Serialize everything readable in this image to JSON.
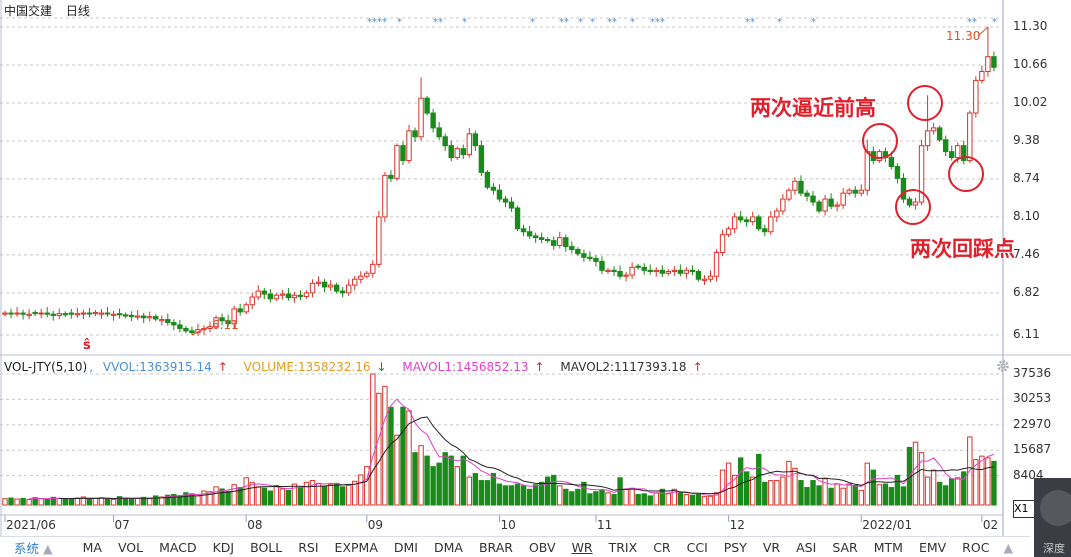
{
  "header": {
    "stock_name": "中国交建",
    "period": "日线"
  },
  "price_axis": {
    "labels": [
      "11.30",
      "10.66",
      "10.02",
      "9.38",
      "8.74",
      "8.10",
      "7.46",
      "6.82",
      "6.11"
    ],
    "range": [
      6.11,
      11.3
    ]
  },
  "volume_axis": {
    "labels": [
      "37536",
      "30253",
      "22970",
      "15687",
      "8404"
    ],
    "max": 37536
  },
  "x_axis": {
    "labels": [
      "2021/06",
      "07",
      "08",
      "09",
      "10",
      "11",
      "12",
      "2022/01",
      "02"
    ],
    "label_candle_index": [
      0,
      18,
      40,
      60,
      82,
      98,
      120,
      142,
      162
    ]
  },
  "legend": {
    "name": "VOL-JTY(5,10)",
    "sep": ",",
    "vvol": "VVOL:1363915.14",
    "vvol_arrow": "↑",
    "volume": "VOLUME:1358232.16",
    "volume_arrow": "↓",
    "mavol1": "MAVOL1:1456852.13",
    "mavol1_arrow": "↑",
    "mavol2": "MAVOL2:1117393.18",
    "mavol2_arrow": "↑"
  },
  "annotations": {
    "near_high": "两次逼近前高",
    "pullback": "两次回踩点",
    "max_label": "11.30",
    "min_label": "6.11",
    "signal_mark": "ŝ"
  },
  "stars": [
    "****",
    "*",
    "**",
    "*",
    "*",
    "**",
    "*",
    "*",
    "**",
    "*",
    "***",
    "**",
    "*",
    "*",
    "**",
    "*"
  ],
  "colors": {
    "up": "#d9352b",
    "down": "#1a8a1a",
    "grid": "#c8c8c8",
    "ma5": "#e040c8",
    "ma10": "#222222",
    "accent": "#2d7fd3",
    "annotation": "#e0202a"
  },
  "tabs": {
    "system": "系统",
    "items": [
      "MA",
      "VOL",
      "MACD",
      "KDJ",
      "BOLL",
      "RSI",
      "EXPMA",
      "DMI",
      "DMA",
      "BRAR",
      "OBV",
      "WR",
      "TRIX",
      "CR",
      "CCI",
      "PSY",
      "VR",
      "ASI",
      "SAR",
      "MTM",
      "EMV",
      "ROC"
    ]
  },
  "side": {
    "zoom_box": "X1",
    "widget_text": "深度"
  },
  "chart_data": {
    "type": "candlestick",
    "title": "中国交建 日线",
    "closes": [
      6.48,
      6.47,
      6.48,
      6.46,
      6.46,
      6.47,
      6.48,
      6.46,
      6.44,
      6.47,
      6.45,
      6.46,
      6.47,
      6.48,
      6.47,
      6.49,
      6.48,
      6.47,
      6.46,
      6.45,
      6.43,
      6.42,
      6.43,
      6.4,
      6.42,
      6.38,
      6.37,
      6.32,
      6.28,
      6.22,
      6.18,
      6.15,
      6.2,
      6.22,
      6.25,
      6.4,
      6.35,
      6.3,
      6.55,
      6.5,
      6.62,
      6.75,
      6.85,
      6.8,
      6.72,
      6.78,
      6.8,
      6.74,
      6.78,
      6.76,
      6.82,
      6.98,
      7.0,
      6.92,
      6.95,
      6.85,
      6.82,
      6.95,
      7.05,
      7.1,
      7.15,
      7.3,
      8.1,
      8.8,
      8.75,
      9.3,
      9.05,
      9.55,
      9.45,
      10.1,
      9.85,
      9.6,
      9.45,
      9.3,
      9.1,
      9.25,
      9.15,
      9.5,
      9.3,
      8.85,
      8.6,
      8.55,
      8.4,
      8.35,
      8.25,
      7.9,
      7.85,
      7.78,
      7.75,
      7.72,
      7.7,
      7.62,
      7.75,
      7.6,
      7.55,
      7.48,
      7.42,
      7.4,
      7.35,
      7.2,
      7.2,
      7.18,
      7.1,
      7.12,
      7.25,
      7.25,
      7.2,
      7.18,
      7.2,
      7.15,
      7.18,
      7.2,
      7.15,
      7.2,
      7.18,
      7.05,
      7.05,
      7.1,
      7.5,
      7.8,
      7.9,
      8.1,
      8.05,
      8.02,
      8.1,
      7.9,
      7.85,
      8.1,
      8.2,
      8.4,
      8.55,
      8.7,
      8.5,
      8.45,
      8.35,
      8.2,
      8.4,
      8.28,
      8.3,
      8.5,
      8.55,
      8.5,
      8.55,
      9.2,
      9.05,
      9.2,
      9.1,
      8.95,
      8.75,
      8.4,
      8.3,
      8.35,
      9.3,
      9.55,
      9.6,
      9.4,
      9.2,
      9.1,
      9.3,
      9.05,
      9.85,
      10.4,
      10.55,
      10.8,
      10.62
    ],
    "high_overrides": {
      "69": 10.45,
      "163": 11.3,
      "153": 10.15,
      "143": 9.4
    },
    "low_overrides": {
      "31": 6.11
    },
    "volumes": [
      1800,
      2000,
      1700,
      1900,
      1600,
      2100,
      1800,
      1700,
      2200,
      1900,
      1600,
      1800,
      2000,
      2300,
      1700,
      1900,
      2100,
      1800,
      1600,
      2400,
      2000,
      1700,
      1900,
      2200,
      1800,
      2600,
      2300,
      2800,
      3000,
      2700,
      3500,
      3200,
      2600,
      4000,
      3800,
      5200,
      4600,
      3900,
      5800,
      5000,
      7800,
      6400,
      5200,
      4800,
      4000,
      5600,
      4600,
      4200,
      6000,
      5000,
      6500,
      7000,
      6200,
      5400,
      5800,
      6200,
      5200,
      5600,
      6800,
      8600,
      11000,
      37536,
      32000,
      34000,
      28000,
      20000,
      28000,
      27000,
      15000,
      17000,
      14000,
      11000,
      12000,
      15000,
      14000,
      11000,
      14000,
      8000,
      9000,
      7000,
      7000,
      9000,
      6000,
      5500,
      5500,
      6000,
      5500,
      4500,
      5800,
      6500,
      8000,
      8500,
      5500,
      4500,
      3800,
      4500,
      6500,
      3200,
      3800,
      4200,
      3500,
      3000,
      7800,
      4500,
      4800,
      3000,
      3200,
      2600,
      3500,
      4500,
      3200,
      4500,
      3400,
      3000,
      2800,
      3000,
      2400,
      2500,
      3500,
      10000,
      12000,
      8500,
      13500,
      9500,
      8000,
      14500,
      6500,
      7000,
      7000,
      8000,
      12500,
      10500,
      7000,
      5000,
      7000,
      5500,
      7500,
      4800,
      6000,
      4800,
      6000,
      5600,
      4200,
      12000,
      10000,
      5800,
      6000,
      5000,
      8500,
      5200,
      16500,
      18000,
      15000,
      8000,
      10000,
      6500,
      5500,
      7500,
      7800,
      9500,
      19500,
      13000,
      14000,
      13500,
      12500
    ],
    "ma_periods": [
      5,
      10
    ]
  }
}
